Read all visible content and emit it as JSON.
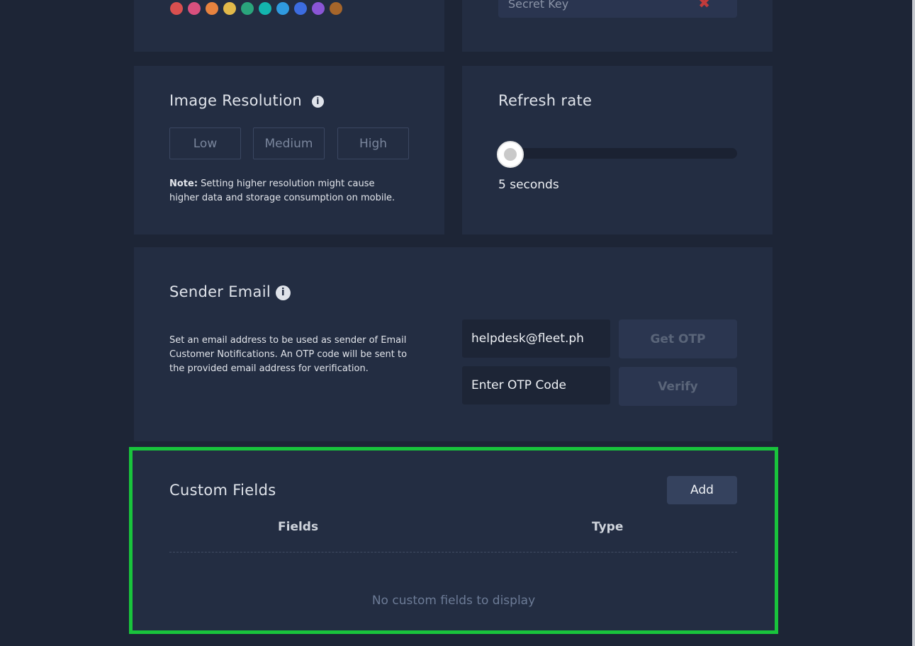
{
  "colors": {
    "swatches": [
      "#d94f4f",
      "#d9507e",
      "#e8833f",
      "#e2b94a",
      "#2aa57c",
      "#13b5af",
      "#2f9ae0",
      "#3c6ce0",
      "#8a55d6",
      "#a6652a"
    ],
    "highlight": "#19c43c"
  },
  "secret_key": {
    "placeholder": "Secret Key",
    "clear_icon": "x-icon"
  },
  "image_resolution": {
    "title": "Image Resolution",
    "options": [
      "Low",
      "Medium",
      "High"
    ],
    "note_label": "Note:",
    "note_text": " Setting higher resolution might cause higher data and storage consumption on mobile."
  },
  "refresh_rate": {
    "title": "Refresh rate",
    "value_seconds": 5,
    "value_label": "5 seconds"
  },
  "sender_email": {
    "title": "Sender Email",
    "description": "Set an email address to be used as sender of Email Customer Notifications. An OTP code will be sent to the provided email address for verification.",
    "email_value": "helpdesk@fleet.ph",
    "otp_placeholder": "Enter OTP Code",
    "get_otp": "Get OTP",
    "verify": "Verify"
  },
  "custom_fields": {
    "title": "Custom Fields",
    "add": "Add",
    "columns": [
      "Fields",
      "Type"
    ],
    "empty": "No custom fields to display"
  }
}
